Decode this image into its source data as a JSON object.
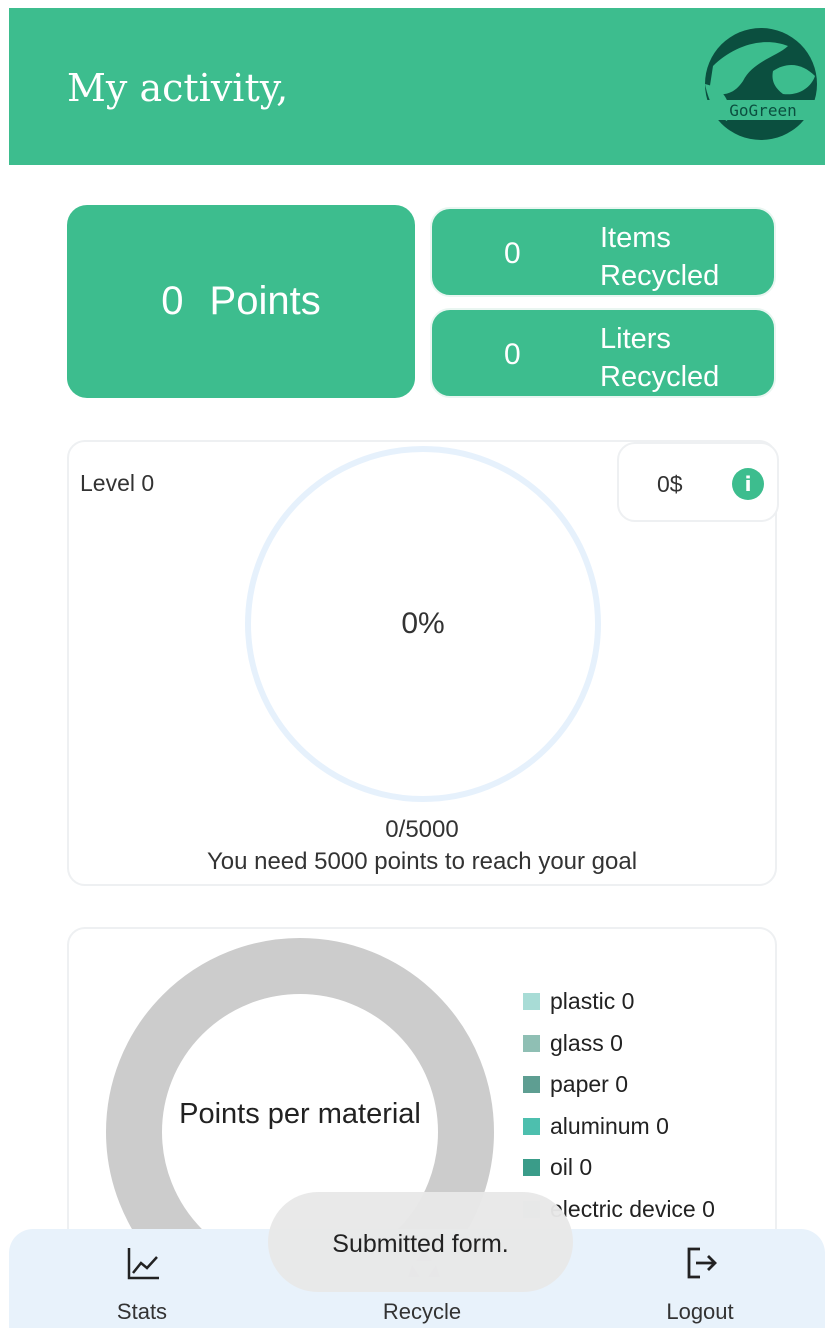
{
  "header": {
    "title": "My activity,",
    "logo_text": "GoGreen"
  },
  "stats": {
    "points_value": "0",
    "points_label": "Points",
    "items_value": "0",
    "items_label": "Items Recycled",
    "liters_value": "0",
    "liters_label": "Liters Recycled"
  },
  "level": {
    "label": "Level 0",
    "money": "0$",
    "info_icon": "info-icon",
    "percent": "0%",
    "progress_fraction": 0,
    "goal_count": "0/5000",
    "goal_message": "You need 5000 points to reach your goal"
  },
  "materials": {
    "center_label": "Points per material",
    "items": [
      {
        "label": "plastic 0",
        "color": "#a8dcd6"
      },
      {
        "label": "glass 0",
        "color": "#8fbfb4"
      },
      {
        "label": "paper 0",
        "color": "#5e9e92"
      },
      {
        "label": "aluminum 0",
        "color": "#4dbfae"
      },
      {
        "label": "oil 0",
        "color": "#3a9c89"
      },
      {
        "label": "electric device 0",
        "color": "#c9e6e0"
      }
    ]
  },
  "nav": {
    "stats_label": "Stats",
    "stats_icon": "chart-line-icon",
    "recycle_label": "Recycle",
    "recycle_icon": "recycle-icon",
    "logout_label": "Logout",
    "logout_icon": "logout-icon"
  },
  "toast": {
    "message": "Submitted form."
  },
  "colors": {
    "primary": "#3dbd8e",
    "ring": "#e6f1fc",
    "donut": "#cccccc",
    "nav_bg": "#e8f2fb"
  }
}
